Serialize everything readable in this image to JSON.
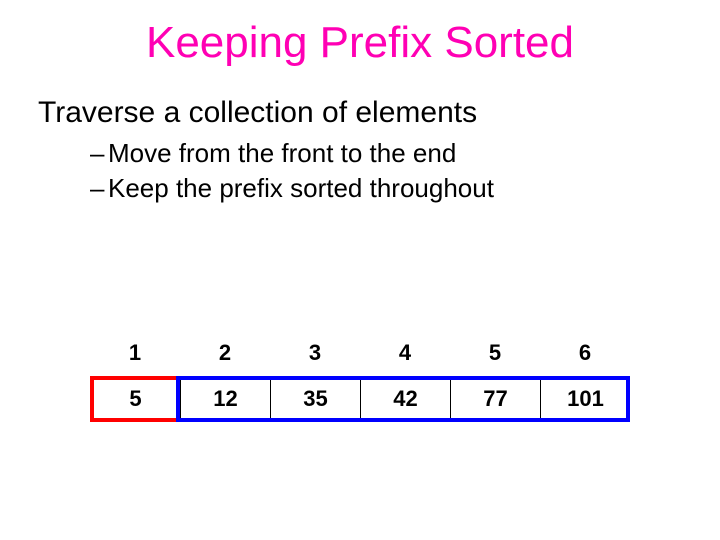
{
  "title": "Keeping Prefix Sorted",
  "intro": "Traverse a collection of elements",
  "bullets": [
    "Move from the front to the end",
    "Keep the prefix sorted throughout"
  ],
  "indices": [
    "1",
    "2",
    "3",
    "4",
    "5",
    "6"
  ],
  "values": [
    "5",
    "12",
    "35",
    "42",
    "77",
    "101"
  ],
  "highlights": {
    "red_cell_index": 0,
    "blue_range": [
      1,
      5
    ]
  }
}
